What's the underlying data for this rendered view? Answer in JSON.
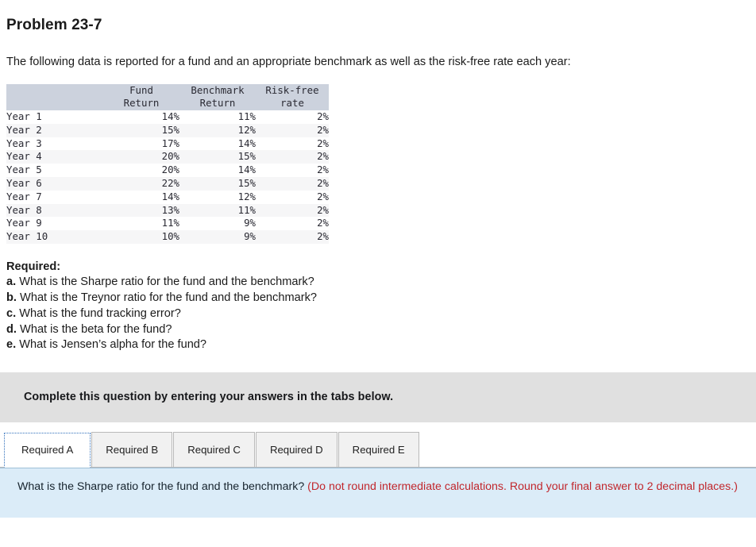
{
  "problem": {
    "title": "Problem 23-7",
    "intro": "The following data is reported for a fund and an appropriate benchmark as well as the risk-free rate each year:"
  },
  "table": {
    "headers": [
      {
        "line1": "",
        "line2": ""
      },
      {
        "line1": "Fund",
        "line2": "Return"
      },
      {
        "line1": "Benchmark",
        "line2": "Return"
      },
      {
        "line1": "Risk-free",
        "line2": "rate"
      }
    ],
    "rows": [
      {
        "label": "Year 1",
        "fund": "14%",
        "benchmark": "11%",
        "riskfree": "2%"
      },
      {
        "label": "Year 2",
        "fund": "15%",
        "benchmark": "12%",
        "riskfree": "2%"
      },
      {
        "label": "Year 3",
        "fund": "17%",
        "benchmark": "14%",
        "riskfree": "2%"
      },
      {
        "label": "Year 4",
        "fund": "20%",
        "benchmark": "15%",
        "riskfree": "2%"
      },
      {
        "label": "Year 5",
        "fund": "20%",
        "benchmark": "14%",
        "riskfree": "2%"
      },
      {
        "label": "Year 6",
        "fund": "22%",
        "benchmark": "15%",
        "riskfree": "2%"
      },
      {
        "label": "Year 7",
        "fund": "14%",
        "benchmark": "12%",
        "riskfree": "2%"
      },
      {
        "label": "Year 8",
        "fund": "13%",
        "benchmark": "11%",
        "riskfree": "2%"
      },
      {
        "label": "Year 9",
        "fund": "11%",
        "benchmark": "9%",
        "riskfree": "2%"
      },
      {
        "label": "Year 10",
        "fund": "10%",
        "benchmark": "9%",
        "riskfree": "2%"
      }
    ]
  },
  "required": {
    "heading": "Required:",
    "items": [
      {
        "letter": "a.",
        "text": "What is the Sharpe ratio for the fund and the benchmark?"
      },
      {
        "letter": "b.",
        "text": "What is the Treynor ratio for the fund and the benchmark?"
      },
      {
        "letter": "c.",
        "text": "What is the fund tracking error?"
      },
      {
        "letter": "d.",
        "text": "What is the beta for the fund?"
      },
      {
        "letter": "e.",
        "text": "What is Jensen’s alpha for the fund?"
      }
    ]
  },
  "instruction": {
    "text": "Complete this question by entering your answers in the tabs below."
  },
  "tabs": [
    {
      "label": "Required A",
      "active": true
    },
    {
      "label": "Required B",
      "active": false
    },
    {
      "label": "Required C",
      "active": false
    },
    {
      "label": "Required D",
      "active": false
    },
    {
      "label": "Required E",
      "active": false
    }
  ],
  "answer_panel": {
    "question": "What is the Sharpe ratio for the fund and the benchmark? ",
    "hint": "(Do not round intermediate calculations. Round your final answer to 2 decimal places.)"
  },
  "colors": {
    "table_header_bg": "#ccd2dd",
    "row_stripe": "#f6f6f7",
    "banner_bg": "#e0e0e0",
    "panel_bg": "#dbecf8",
    "panel_border": "#9fc0d8",
    "hint_red": "#c1272d",
    "tab_active_outline": "#2f6fbb"
  }
}
